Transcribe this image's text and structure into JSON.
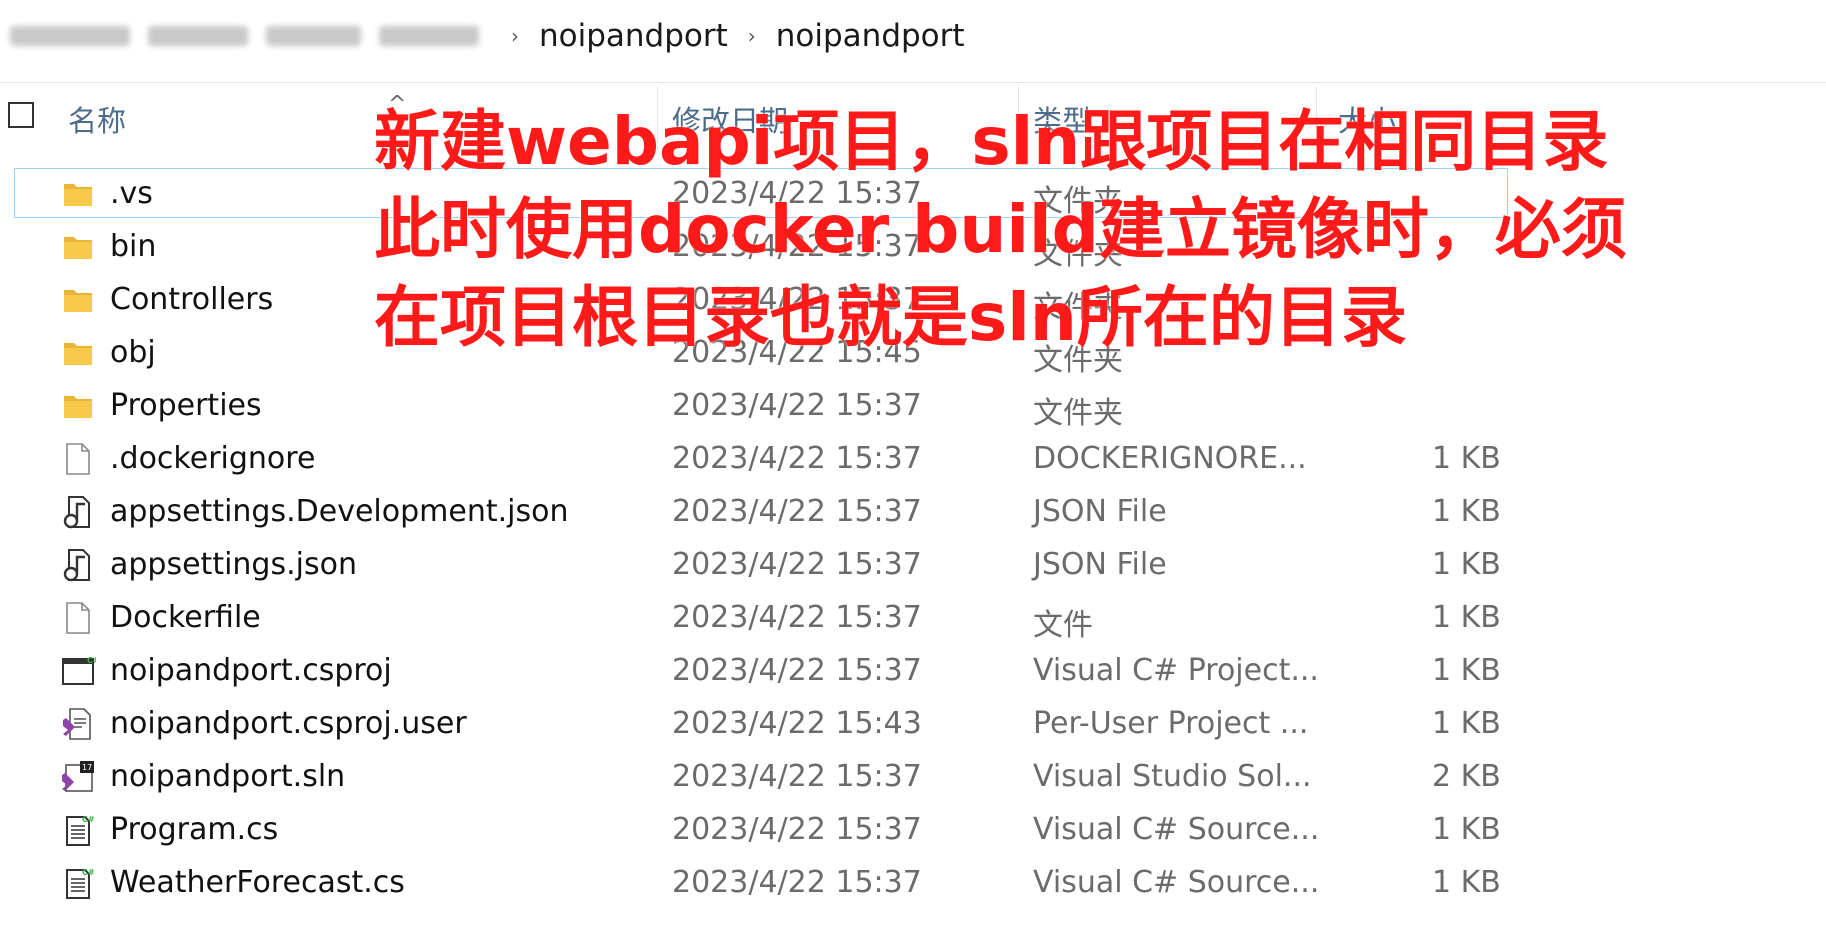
{
  "breadcrumb": {
    "segments": [
      "noipandport",
      "noipandport"
    ],
    "separator": "›"
  },
  "header": {
    "name": "名称",
    "date": "修改日期",
    "type": "类型",
    "size": "大小"
  },
  "files": [
    {
      "name": ".vs",
      "date": "2023/4/22 15:37",
      "type": "文件夹",
      "size": "",
      "icon": "folder-icon"
    },
    {
      "name": "bin",
      "date": "2023/4/22 15:37",
      "type": "文件夹",
      "size": "",
      "icon": "folder-icon"
    },
    {
      "name": "Controllers",
      "date": "2023/4/22 15:37",
      "type": "文件夹",
      "size": "",
      "icon": "folder-icon"
    },
    {
      "name": "obj",
      "date": "2023/4/22 15:45",
      "type": "文件夹",
      "size": "",
      "icon": "folder-icon"
    },
    {
      "name": "Properties",
      "date": "2023/4/22 15:37",
      "type": "文件夹",
      "size": "",
      "icon": "folder-icon"
    },
    {
      "name": ".dockerignore",
      "date": "2023/4/22 15:37",
      "type": "DOCKERIGNORE...",
      "size": "1 KB",
      "icon": "blank-file-icon"
    },
    {
      "name": "appsettings.Development.json",
      "date": "2023/4/22 15:37",
      "type": "JSON File",
      "size": "1 KB",
      "icon": "json-file-icon"
    },
    {
      "name": "appsettings.json",
      "date": "2023/4/22 15:37",
      "type": "JSON File",
      "size": "1 KB",
      "icon": "json-file-icon"
    },
    {
      "name": "Dockerfile",
      "date": "2023/4/22 15:37",
      "type": "文件",
      "size": "1 KB",
      "icon": "blank-file-icon"
    },
    {
      "name": "noipandport.csproj",
      "date": "2023/4/22 15:37",
      "type": "Visual C# Project...",
      "size": "1 KB",
      "icon": "csproj-file-icon"
    },
    {
      "name": "noipandport.csproj.user",
      "date": "2023/4/22 15:43",
      "type": "Per-User Project ...",
      "size": "1 KB",
      "icon": "vs-user-file-icon"
    },
    {
      "name": "noipandport.sln",
      "date": "2023/4/22 15:37",
      "type": "Visual Studio Sol...",
      "size": "2 KB",
      "icon": "vs-solution-file-icon"
    },
    {
      "name": "Program.cs",
      "date": "2023/4/22 15:37",
      "type": "Visual C# Source...",
      "size": "1 KB",
      "icon": "cs-source-file-icon"
    },
    {
      "name": "WeatherForecast.cs",
      "date": "2023/4/22 15:37",
      "type": "Visual C# Source...",
      "size": "1 KB",
      "icon": "cs-source-file-icon"
    }
  ],
  "annotation": {
    "lines": [
      "新建webapi项目，sln跟项目在相同目录",
      "此时使用docker build建立镜像时，必须",
      "在项目根目录也就是sln所在的目录"
    ],
    "color": "#ff1a1a"
  }
}
